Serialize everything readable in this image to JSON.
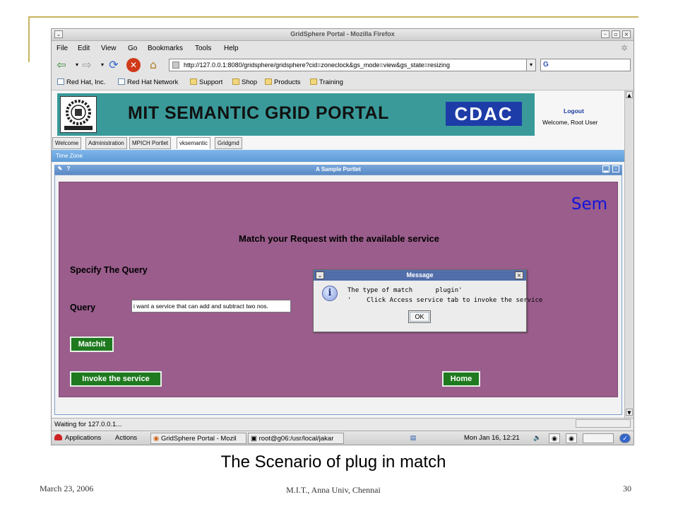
{
  "window": {
    "title": "GridSphere Portal - Mozilla Firefox"
  },
  "menu": [
    "File",
    "Edit",
    "View",
    "Go",
    "Bookmarks",
    "Tools",
    "Help"
  ],
  "navbar": {
    "url": "http://127.0.0.1:8080/gridsphere/gridsphere?cid=zoneclock&gs_mode=view&gs_state=resizing",
    "search_prefix": "G"
  },
  "bookmarks": [
    "Red Hat, Inc.",
    "Red Hat Network",
    "Support",
    "Shop",
    "Products",
    "Training"
  ],
  "portal": {
    "title": "MIT SEMANTIC GRID PORTAL",
    "partner_logo": "CDAC",
    "logout": "Logout",
    "welcome": "Welcome, Root User",
    "tabs": [
      "Welcome",
      "Administration",
      "MPICH Portlet",
      "vksemantic",
      "Gridgmd"
    ],
    "active_tab": "vksemantic",
    "subnav": "Time Zone"
  },
  "portlet": {
    "title": "A Sample Portlet",
    "corner_text": "Sem",
    "heading": "Match your Request with the available service",
    "specify_label": "Specify The Query",
    "query_label": "Query",
    "query_value": "i want a service that can add and subtract two nos.",
    "matchit_button": "Matchit",
    "invoke_button": "Invoke the service",
    "home_button": "Home"
  },
  "dialog": {
    "title": "Message",
    "line1": "The type of match      plugin'",
    "line2": "'    Click Access service tab to invoke the service",
    "ok": "OK"
  },
  "status": {
    "text": "Waiting for 127.0.0.1..."
  },
  "taskbar": {
    "applications": "Applications",
    "actions": "Actions",
    "task1": "GridSphere Portal - Mozil",
    "task2": "root@g06:/usr/local/jakar",
    "clock": "Mon Jan 16, 12:21"
  },
  "slide": {
    "caption": "The Scenario of plug in match",
    "date": "March 23, 2006",
    "org": "M.I.T., Anna Univ, Chennai",
    "page": "30"
  },
  "colors": {
    "portlet_bg": "#9a5d8c",
    "banner_bg": "#3a9a9a",
    "button_green": "#1f7a1f",
    "slide_accent": "#c8b460"
  }
}
